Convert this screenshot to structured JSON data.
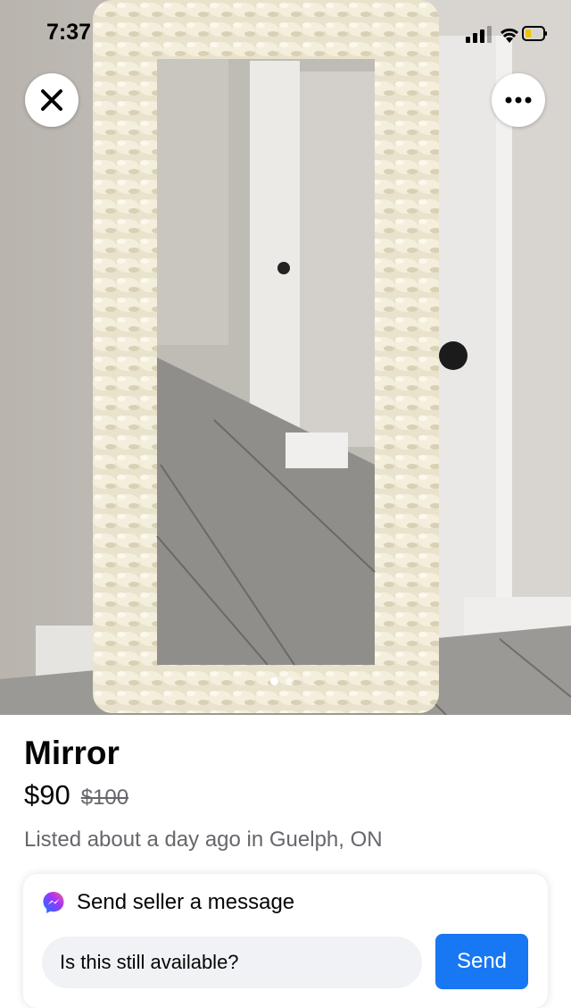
{
  "status_bar": {
    "time": "7:37"
  },
  "photo": {
    "subject": "listing-photo",
    "page_count": 2,
    "current_page": 1
  },
  "toolbar": {
    "close_icon": "close-icon",
    "more_icon": "more-icon"
  },
  "listing": {
    "title": "Mirror",
    "price": "$90",
    "original_price": "$100",
    "listed_text": "Listed about a day ago in Guelph, ON"
  },
  "message": {
    "header": "Send seller a message",
    "input_value": "Is this still available?",
    "send_label": "Send",
    "icon": "messenger-icon"
  },
  "colors": {
    "accent": "#1877f2",
    "secondary_text": "#65676b",
    "input_bg": "#f0f2f5"
  }
}
